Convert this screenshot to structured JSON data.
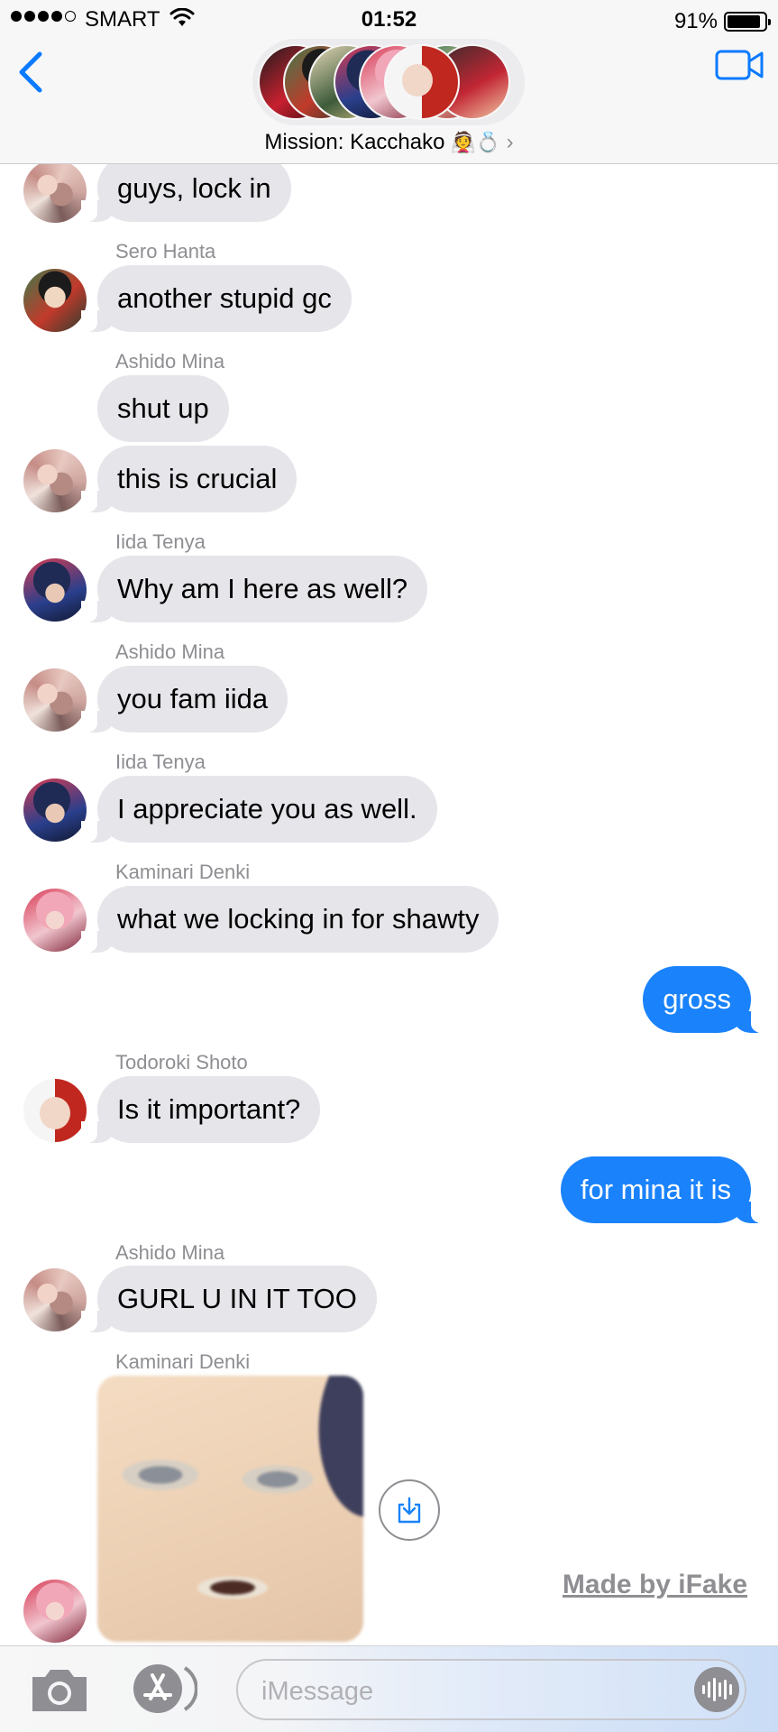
{
  "status_bar": {
    "carrier": "SMART",
    "time": "01:52",
    "battery": "91%"
  },
  "header": {
    "title": "Mission: Kacchako",
    "title_emoji": "👰💍",
    "chevron": "›",
    "icons": [
      "back-chevron-icon",
      "video-camera-icon"
    ]
  },
  "messages": [
    {
      "sender": "",
      "text": "guys, lock in",
      "direction": "in"
    },
    {
      "sender": "Sero Hanta",
      "text": "another stupid gc",
      "direction": "in"
    },
    {
      "sender": "Ashido Mina",
      "text": "shut up",
      "direction": "in"
    },
    {
      "sender": "",
      "text": "this is crucial",
      "direction": "in"
    },
    {
      "sender": "Iida Tenya",
      "text": "Why am I here as well?",
      "direction": "in"
    },
    {
      "sender": "Ashido Mina",
      "text": "you fam iida",
      "direction": "in"
    },
    {
      "sender": "Iida Tenya",
      "text": "I appreciate you as well.",
      "direction": "in"
    },
    {
      "sender": "Kaminari Denki",
      "text": "what we locking in for shawty",
      "direction": "in"
    },
    {
      "sender": "",
      "text": "gross",
      "direction": "out"
    },
    {
      "sender": "Todoroki Shoto",
      "text": "Is it important?",
      "direction": "in"
    },
    {
      "sender": "",
      "text": "for mina it is",
      "direction": "out"
    },
    {
      "sender": "Ashido Mina",
      "text": "GURL U IN IT TOO",
      "direction": "in"
    },
    {
      "sender": "Kaminari Denki",
      "text": "",
      "direction": "in"
    }
  ],
  "watermark": "Made by iFake",
  "input": {
    "placeholder": "iMessage",
    "icons": [
      "camera-icon",
      "app-store-icon",
      "audio-waveform-icon",
      "download-icon"
    ]
  },
  "colors": {
    "outgoing_bubble": "#1a82fb",
    "incoming_bubble": "#e5e5ea",
    "accent": "#0a7aff",
    "secondary_text": "#8e8e93"
  }
}
